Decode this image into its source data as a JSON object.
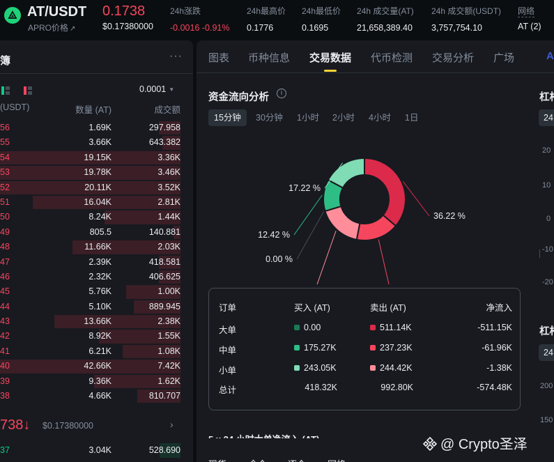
{
  "ticker": {
    "symbol": "AT/USDT",
    "sub_label": "APRO价格",
    "sub_icon": "external-link-icon",
    "last_price": "0.1738",
    "last_price_usd": "$0.17380000",
    "stats": [
      {
        "key": "24h涨跌",
        "value": "-0.0016 -0.91%",
        "negative": true
      },
      {
        "key": "24h最高价",
        "value": "0.1776"
      },
      {
        "key": "24h最低价",
        "value": "0.1695"
      },
      {
        "key": "24h 成交量(AT)",
        "value": "21,658,389.40"
      },
      {
        "key": "24h 成交额(USDT)",
        "value": "3,757,754.10"
      },
      {
        "key": "网络",
        "value": "AT (2)"
      }
    ],
    "colors": {
      "up": "#0ecb81",
      "down": "#f6465d",
      "logo": "#1fd27a"
    }
  },
  "order_book": {
    "title": "簿",
    "more_icon": "more-icon",
    "tick_size": "0.0001",
    "columns": [
      "(USDT)",
      "数量 (AT)",
      "成交额"
    ],
    "asks": [
      {
        "price": "56",
        "qty": "1.69K",
        "total": "297.958",
        "depth": 0.12
      },
      {
        "price": "55",
        "qty": "3.66K",
        "total": "643.382",
        "depth": 0.1
      },
      {
        "price": "54",
        "qty": "19.15K",
        "total": "3.36K",
        "depth": 1.0
      },
      {
        "price": "53",
        "qty": "19.78K",
        "total": "3.46K",
        "depth": 1.0
      },
      {
        "price": "52",
        "qty": "20.11K",
        "total": "3.52K",
        "depth": 1.0
      },
      {
        "price": "51",
        "qty": "16.04K",
        "total": "2.81K",
        "depth": 0.82
      },
      {
        "price": "50",
        "qty": "8.24K",
        "total": "1.44K",
        "depth": 0.42
      },
      {
        "price": "49",
        "qty": "805.5",
        "total": "140.881",
        "depth": 0.04
      },
      {
        "price": "48",
        "qty": "11.66K",
        "total": "2.03K",
        "depth": 0.6
      },
      {
        "price": "47",
        "qty": "2.39K",
        "total": "418.581",
        "depth": 0.12
      },
      {
        "price": "46",
        "qty": "2.32K",
        "total": "406.625",
        "depth": 0.12
      },
      {
        "price": "45",
        "qty": "5.76K",
        "total": "1.00K",
        "depth": 0.3
      },
      {
        "price": "44",
        "qty": "5.10K",
        "total": "889.945",
        "depth": 0.26
      },
      {
        "price": "43",
        "qty": "13.66K",
        "total": "2.38K",
        "depth": 0.7
      },
      {
        "price": "42",
        "qty": "8.92K",
        "total": "1.55K",
        "depth": 0.45
      },
      {
        "price": "41",
        "qty": "6.21K",
        "total": "1.08K",
        "depth": 0.32
      },
      {
        "price": "40",
        "qty": "42.66K",
        "total": "7.42K",
        "depth": 1.0
      },
      {
        "price": "39",
        "qty": "9.36K",
        "total": "1.62K",
        "depth": 0.48
      },
      {
        "price": "38",
        "qty": "4.66K",
        "total": "810.707",
        "depth": 0.24
      }
    ],
    "mid_price": "738",
    "mid_arrow": "↓",
    "mid_usd": "$0.17380000",
    "mid_chevron": "chevron-right-icon",
    "bids": [
      {
        "price": "37",
        "qty": "3.04K",
        "total": "528.690"
      }
    ]
  },
  "tabs": {
    "items": [
      "图表",
      "币种信息",
      "交易数据",
      "代币检测",
      "交易分析",
      "广场"
    ],
    "active": "交易数据",
    "extra": "A"
  },
  "capital_flow": {
    "title": "资金流向分析",
    "info_icon": "info-icon",
    "periods": [
      "15分钟",
      "30分钟",
      "1小时",
      "2小时",
      "4小时",
      "1日"
    ],
    "active_period": "15分钟",
    "chart_data": {
      "type": "pie",
      "donut": true,
      "slices": [
        {
          "label": "36.22 %",
          "value": 36.22,
          "color": "#dc2a4a"
        },
        {
          "label": "16.81 %",
          "value": 16.81,
          "color": "#f6465d"
        },
        {
          "label": "17.32 %",
          "value": 17.32,
          "color": "#ff8d9a"
        },
        {
          "label": "0.00 %",
          "value": 0.0,
          "color": "#1b7a54"
        },
        {
          "label": "12.42 %",
          "value": 12.42,
          "color": "#2ebd85"
        },
        {
          "label": "17.22 %",
          "value": 17.22,
          "color": "#7fdcb4"
        }
      ]
    },
    "table": {
      "headers": [
        "订单",
        "买入 (AT)",
        "卖出 (AT)",
        "净流入"
      ],
      "rows": [
        {
          "label": "大单",
          "buy": "0.00",
          "sell": "511.14K",
          "net": "-511.15K",
          "buy_color": "#1b7a54",
          "sell_color": "#dc2a4a"
        },
        {
          "label": "中单",
          "buy": "175.27K",
          "sell": "237.23K",
          "net": "-61.96K",
          "buy_color": "#2ebd85",
          "sell_color": "#f6465d"
        },
        {
          "label": "小单",
          "buy": "243.05K",
          "sell": "244.42K",
          "net": "-1.38K",
          "buy_color": "#7fdcb4",
          "sell_color": "#ff8d9a"
        },
        {
          "label": "总计",
          "buy": "418.32K",
          "sell": "992.80K",
          "net": "-574.48K"
        }
      ]
    },
    "next_title": "5 x 24 小时大单净流入 (AT)"
  },
  "bottom_tabs": [
    "现货",
    "全仓",
    "逐仓",
    "网格"
  ],
  "side_panel": {
    "title": "杠杆",
    "btn": "24",
    "axis": [
      "20",
      "10",
      "0",
      "-10",
      "-20"
    ],
    "title2": "杠杆",
    "btn2": "24",
    "axis2": [
      "200",
      "150"
    ]
  },
  "watermark": "@ Crypto圣泽"
}
